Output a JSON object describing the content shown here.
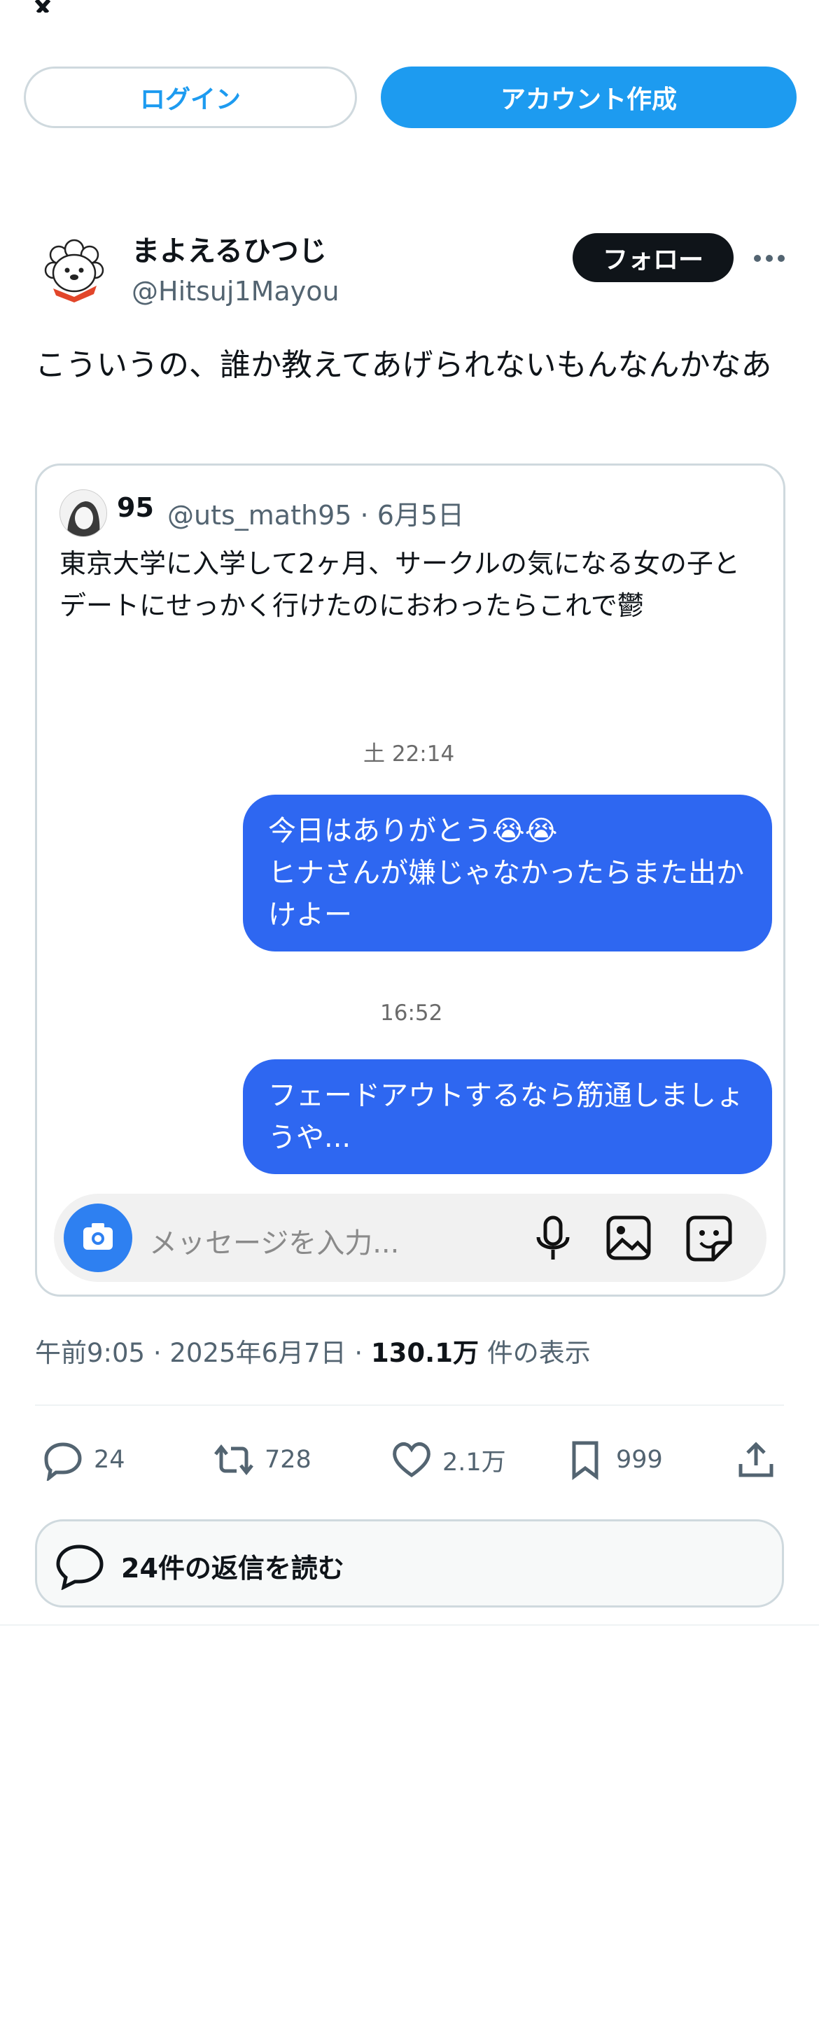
{
  "header": {
    "logo": "x-logo",
    "login_label": "ログイン",
    "signup_label": "アカウント作成"
  },
  "post": {
    "display_name": "まよえるひつじ",
    "handle": "@Hitsuj1Mayou",
    "follow_label": "フォロー",
    "text": "こういうの、誰か教えてあげられないもんなんかなあ",
    "quote": {
      "name": "95",
      "handle": "@uts_math95",
      "date": "6月5日",
      "text": "東京大学に入学して2ヶ月、サークルの気になる女の子とデートにせっかく行けたのにおわったらこれで鬱",
      "chat": {
        "time1": "土 22:14",
        "bubble1_line1": "今日はありがとう😭😭",
        "bubble1_line2": "ヒナさんが嫌じゃなかったらまた出かけよー",
        "time2": "16:52",
        "bubble2": "フェードアウトするなら筋通しましょうや...",
        "input_placeholder": "メッセージを入力..."
      }
    },
    "timestamp": {
      "time": "午前9:05",
      "date": "2025年6月7日",
      "views_count": "130.1万",
      "views_label": "件の表示"
    },
    "actions": {
      "replies": "24",
      "reposts": "728",
      "likes": "2.1万",
      "bookmarks": "999"
    },
    "read_replies_label": "24件の返信を読む"
  },
  "colors": {
    "accent": "#1d9bf0",
    "bubble": "#2e67f1",
    "text": "#0f1419",
    "muted": "#536471"
  }
}
